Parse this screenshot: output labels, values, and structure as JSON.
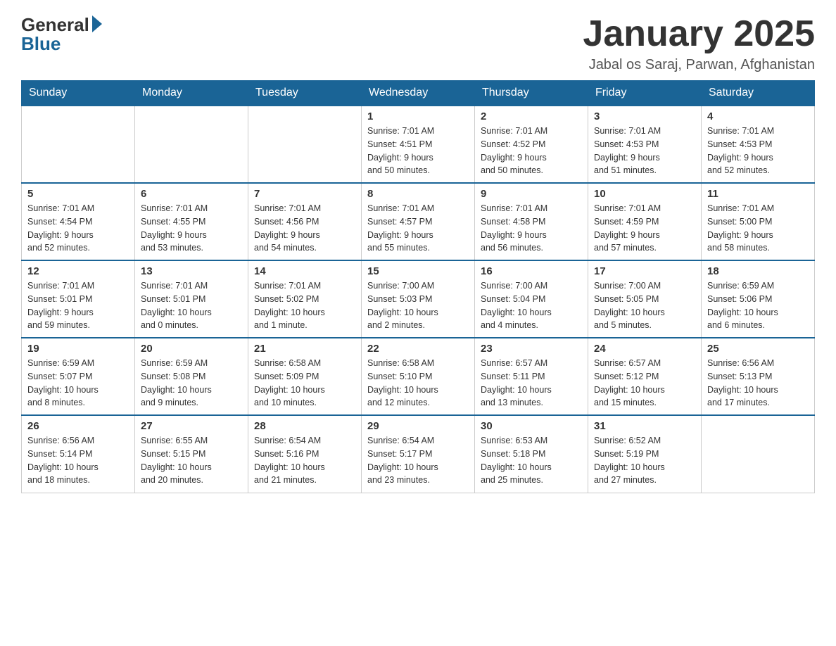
{
  "header": {
    "logo_general": "General",
    "logo_blue": "Blue",
    "title": "January 2025",
    "location": "Jabal os Saraj, Parwan, Afghanistan"
  },
  "calendar": {
    "days_of_week": [
      "Sunday",
      "Monday",
      "Tuesday",
      "Wednesday",
      "Thursday",
      "Friday",
      "Saturday"
    ],
    "weeks": [
      [
        {
          "day": "",
          "info": ""
        },
        {
          "day": "",
          "info": ""
        },
        {
          "day": "",
          "info": ""
        },
        {
          "day": "1",
          "info": "Sunrise: 7:01 AM\nSunset: 4:51 PM\nDaylight: 9 hours\nand 50 minutes."
        },
        {
          "day": "2",
          "info": "Sunrise: 7:01 AM\nSunset: 4:52 PM\nDaylight: 9 hours\nand 50 minutes."
        },
        {
          "day": "3",
          "info": "Sunrise: 7:01 AM\nSunset: 4:53 PM\nDaylight: 9 hours\nand 51 minutes."
        },
        {
          "day": "4",
          "info": "Sunrise: 7:01 AM\nSunset: 4:53 PM\nDaylight: 9 hours\nand 52 minutes."
        }
      ],
      [
        {
          "day": "5",
          "info": "Sunrise: 7:01 AM\nSunset: 4:54 PM\nDaylight: 9 hours\nand 52 minutes."
        },
        {
          "day": "6",
          "info": "Sunrise: 7:01 AM\nSunset: 4:55 PM\nDaylight: 9 hours\nand 53 minutes."
        },
        {
          "day": "7",
          "info": "Sunrise: 7:01 AM\nSunset: 4:56 PM\nDaylight: 9 hours\nand 54 minutes."
        },
        {
          "day": "8",
          "info": "Sunrise: 7:01 AM\nSunset: 4:57 PM\nDaylight: 9 hours\nand 55 minutes."
        },
        {
          "day": "9",
          "info": "Sunrise: 7:01 AM\nSunset: 4:58 PM\nDaylight: 9 hours\nand 56 minutes."
        },
        {
          "day": "10",
          "info": "Sunrise: 7:01 AM\nSunset: 4:59 PM\nDaylight: 9 hours\nand 57 minutes."
        },
        {
          "day": "11",
          "info": "Sunrise: 7:01 AM\nSunset: 5:00 PM\nDaylight: 9 hours\nand 58 minutes."
        }
      ],
      [
        {
          "day": "12",
          "info": "Sunrise: 7:01 AM\nSunset: 5:01 PM\nDaylight: 9 hours\nand 59 minutes."
        },
        {
          "day": "13",
          "info": "Sunrise: 7:01 AM\nSunset: 5:01 PM\nDaylight: 10 hours\nand 0 minutes."
        },
        {
          "day": "14",
          "info": "Sunrise: 7:01 AM\nSunset: 5:02 PM\nDaylight: 10 hours\nand 1 minute."
        },
        {
          "day": "15",
          "info": "Sunrise: 7:00 AM\nSunset: 5:03 PM\nDaylight: 10 hours\nand 2 minutes."
        },
        {
          "day": "16",
          "info": "Sunrise: 7:00 AM\nSunset: 5:04 PM\nDaylight: 10 hours\nand 4 minutes."
        },
        {
          "day": "17",
          "info": "Sunrise: 7:00 AM\nSunset: 5:05 PM\nDaylight: 10 hours\nand 5 minutes."
        },
        {
          "day": "18",
          "info": "Sunrise: 6:59 AM\nSunset: 5:06 PM\nDaylight: 10 hours\nand 6 minutes."
        }
      ],
      [
        {
          "day": "19",
          "info": "Sunrise: 6:59 AM\nSunset: 5:07 PM\nDaylight: 10 hours\nand 8 minutes."
        },
        {
          "day": "20",
          "info": "Sunrise: 6:59 AM\nSunset: 5:08 PM\nDaylight: 10 hours\nand 9 minutes."
        },
        {
          "day": "21",
          "info": "Sunrise: 6:58 AM\nSunset: 5:09 PM\nDaylight: 10 hours\nand 10 minutes."
        },
        {
          "day": "22",
          "info": "Sunrise: 6:58 AM\nSunset: 5:10 PM\nDaylight: 10 hours\nand 12 minutes."
        },
        {
          "day": "23",
          "info": "Sunrise: 6:57 AM\nSunset: 5:11 PM\nDaylight: 10 hours\nand 13 minutes."
        },
        {
          "day": "24",
          "info": "Sunrise: 6:57 AM\nSunset: 5:12 PM\nDaylight: 10 hours\nand 15 minutes."
        },
        {
          "day": "25",
          "info": "Sunrise: 6:56 AM\nSunset: 5:13 PM\nDaylight: 10 hours\nand 17 minutes."
        }
      ],
      [
        {
          "day": "26",
          "info": "Sunrise: 6:56 AM\nSunset: 5:14 PM\nDaylight: 10 hours\nand 18 minutes."
        },
        {
          "day": "27",
          "info": "Sunrise: 6:55 AM\nSunset: 5:15 PM\nDaylight: 10 hours\nand 20 minutes."
        },
        {
          "day": "28",
          "info": "Sunrise: 6:54 AM\nSunset: 5:16 PM\nDaylight: 10 hours\nand 21 minutes."
        },
        {
          "day": "29",
          "info": "Sunrise: 6:54 AM\nSunset: 5:17 PM\nDaylight: 10 hours\nand 23 minutes."
        },
        {
          "day": "30",
          "info": "Sunrise: 6:53 AM\nSunset: 5:18 PM\nDaylight: 10 hours\nand 25 minutes."
        },
        {
          "day": "31",
          "info": "Sunrise: 6:52 AM\nSunset: 5:19 PM\nDaylight: 10 hours\nand 27 minutes."
        },
        {
          "day": "",
          "info": ""
        }
      ]
    ]
  }
}
